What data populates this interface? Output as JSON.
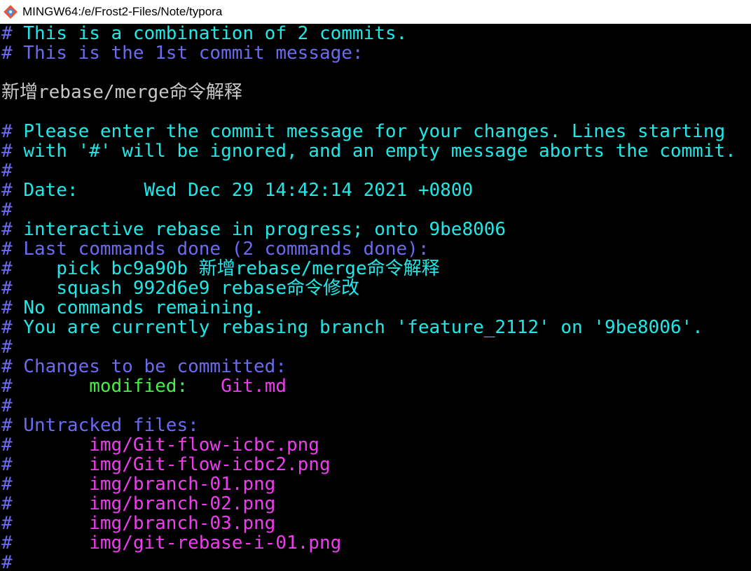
{
  "window": {
    "title": "MINGW64:/e/Frost2-Files/Note/typora",
    "icon": "git-bash-icon"
  },
  "colors": {
    "background": "#000000",
    "comment_cyan": "#1fe8e8",
    "header_blue": "#6b6bf2",
    "text_white": "#c8c8c8",
    "modified_green": "#44f044",
    "file_magenta": "#f03cf0"
  },
  "lines": [
    {
      "segments": [
        {
          "text": "# ",
          "color": "blue"
        },
        {
          "text": "This is a combination of 2 commits.",
          "color": "cyan"
        }
      ]
    },
    {
      "segments": [
        {
          "text": "# This is the 1st commit message:",
          "color": "blue"
        }
      ]
    },
    {
      "segments": []
    },
    {
      "segments": [
        {
          "text": "新增rebase/merge命令解释",
          "color": "white"
        }
      ]
    },
    {
      "segments": []
    },
    {
      "segments": [
        {
          "text": "# ",
          "color": "blue"
        },
        {
          "text": "Please enter the commit message for your changes. Lines starting",
          "color": "cyan"
        }
      ]
    },
    {
      "segments": [
        {
          "text": "# ",
          "color": "blue"
        },
        {
          "text": "with '#' will be ignored, and an empty message aborts the commit.",
          "color": "cyan"
        }
      ]
    },
    {
      "segments": [
        {
          "text": "#",
          "color": "blue"
        }
      ]
    },
    {
      "segments": [
        {
          "text": "# ",
          "color": "blue"
        },
        {
          "text": "Date:      Wed Dec 29 14:42:14 2021 +0800",
          "color": "cyan"
        }
      ]
    },
    {
      "segments": [
        {
          "text": "#",
          "color": "blue"
        }
      ]
    },
    {
      "segments": [
        {
          "text": "# ",
          "color": "blue"
        },
        {
          "text": "interactive rebase in progress; onto 9be8006",
          "color": "cyan"
        }
      ]
    },
    {
      "segments": [
        {
          "text": "# Last commands done (2 commands done):",
          "color": "blue"
        }
      ]
    },
    {
      "segments": [
        {
          "text": "#",
          "color": "blue"
        },
        {
          "text": "    pick bc9a90b 新增rebase/merge命令解释",
          "color": "cyan"
        }
      ]
    },
    {
      "segments": [
        {
          "text": "#",
          "color": "blue"
        },
        {
          "text": "    squash 992d6e9 rebase命令修改",
          "color": "cyan"
        }
      ]
    },
    {
      "segments": [
        {
          "text": "# ",
          "color": "blue"
        },
        {
          "text": "No commands remaining.",
          "color": "cyan"
        }
      ]
    },
    {
      "segments": [
        {
          "text": "# ",
          "color": "blue"
        },
        {
          "text": "You are currently rebasing branch 'feature_2112' on '9be8006'.",
          "color": "cyan"
        }
      ]
    },
    {
      "segments": [
        {
          "text": "#",
          "color": "blue"
        }
      ]
    },
    {
      "segments": [
        {
          "text": "# Changes to be committed:",
          "color": "blue"
        }
      ]
    },
    {
      "segments": [
        {
          "text": "#",
          "color": "blue"
        },
        {
          "text": "       modified:   ",
          "color": "green"
        },
        {
          "text": "Git.md",
          "color": "magenta"
        }
      ]
    },
    {
      "segments": [
        {
          "text": "#",
          "color": "blue"
        }
      ]
    },
    {
      "segments": [
        {
          "text": "# Untracked files:",
          "color": "blue"
        }
      ]
    },
    {
      "segments": [
        {
          "text": "#",
          "color": "blue"
        },
        {
          "text": "       img/Git-flow-icbc.png",
          "color": "magenta"
        }
      ]
    },
    {
      "segments": [
        {
          "text": "#",
          "color": "blue"
        },
        {
          "text": "       img/Git-flow-icbc2.png",
          "color": "magenta"
        }
      ]
    },
    {
      "segments": [
        {
          "text": "#",
          "color": "blue"
        },
        {
          "text": "       img/branch-01.png",
          "color": "magenta"
        }
      ]
    },
    {
      "segments": [
        {
          "text": "#",
          "color": "blue"
        },
        {
          "text": "       img/branch-02.png",
          "color": "magenta"
        }
      ]
    },
    {
      "segments": [
        {
          "text": "#",
          "color": "blue"
        },
        {
          "text": "       img/branch-03.png",
          "color": "magenta"
        }
      ]
    },
    {
      "segments": [
        {
          "text": "#",
          "color": "blue"
        },
        {
          "text": "       img/git-rebase-i-01.png",
          "color": "magenta"
        }
      ]
    },
    {
      "segments": [
        {
          "text": "#",
          "color": "blue"
        }
      ]
    }
  ]
}
